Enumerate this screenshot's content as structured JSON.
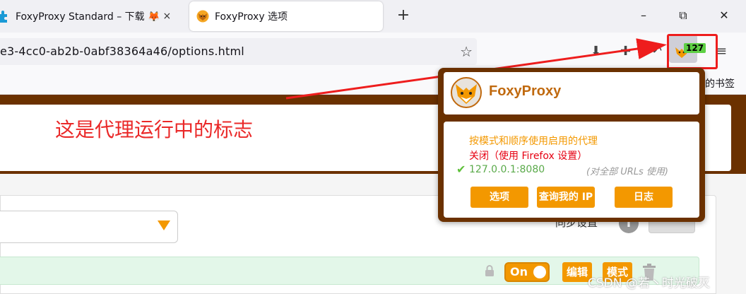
{
  "tabs": [
    {
      "label": "FoxyProxy Standard – 下载 🦊",
      "close": "×"
    },
    {
      "label": "FoxyProxy 选项"
    }
  ],
  "new_tab": "+",
  "window_controls": {
    "minimize": "–",
    "restore": "⧉",
    "close": "✕"
  },
  "url": "e3-4cc0-ab2b-0abf38364a46/options.html",
  "nav_icons": {
    "bookmark_star": "☆",
    "download": "⬇",
    "extensions": "✚",
    "back": "↶",
    "menu": "≡"
  },
  "extension_badge": "127",
  "bookmarks_bar": {
    "label": "的书签"
  },
  "annotation": {
    "text": "这是代理运行中的标志",
    "color": "#ea2828"
  },
  "page": {
    "sync_label": "同步设置",
    "info": "i",
    "on_label": "On",
    "edit_label": "编辑",
    "patterns_label": "模式"
  },
  "popup": {
    "title": "FoxyProxy",
    "options": {
      "patterns": "按模式和顺序使用启用的代理",
      "off": "关闭（使用 Firefox 设置）",
      "proxy": "127.0.0.1:8080",
      "proxy_note": "(对全部 URLs 使用)",
      "check": "✔"
    },
    "buttons": {
      "options": "选项",
      "whats_my_ip": "查询我的 IP",
      "log": "日志"
    }
  },
  "watermark": "CSDN @若丶时光破灭",
  "colors": {
    "accent": "#f39800",
    "brand_brown": "#6b3100",
    "annotation_red": "#ea2828",
    "badge_green": "#5ed045"
  }
}
